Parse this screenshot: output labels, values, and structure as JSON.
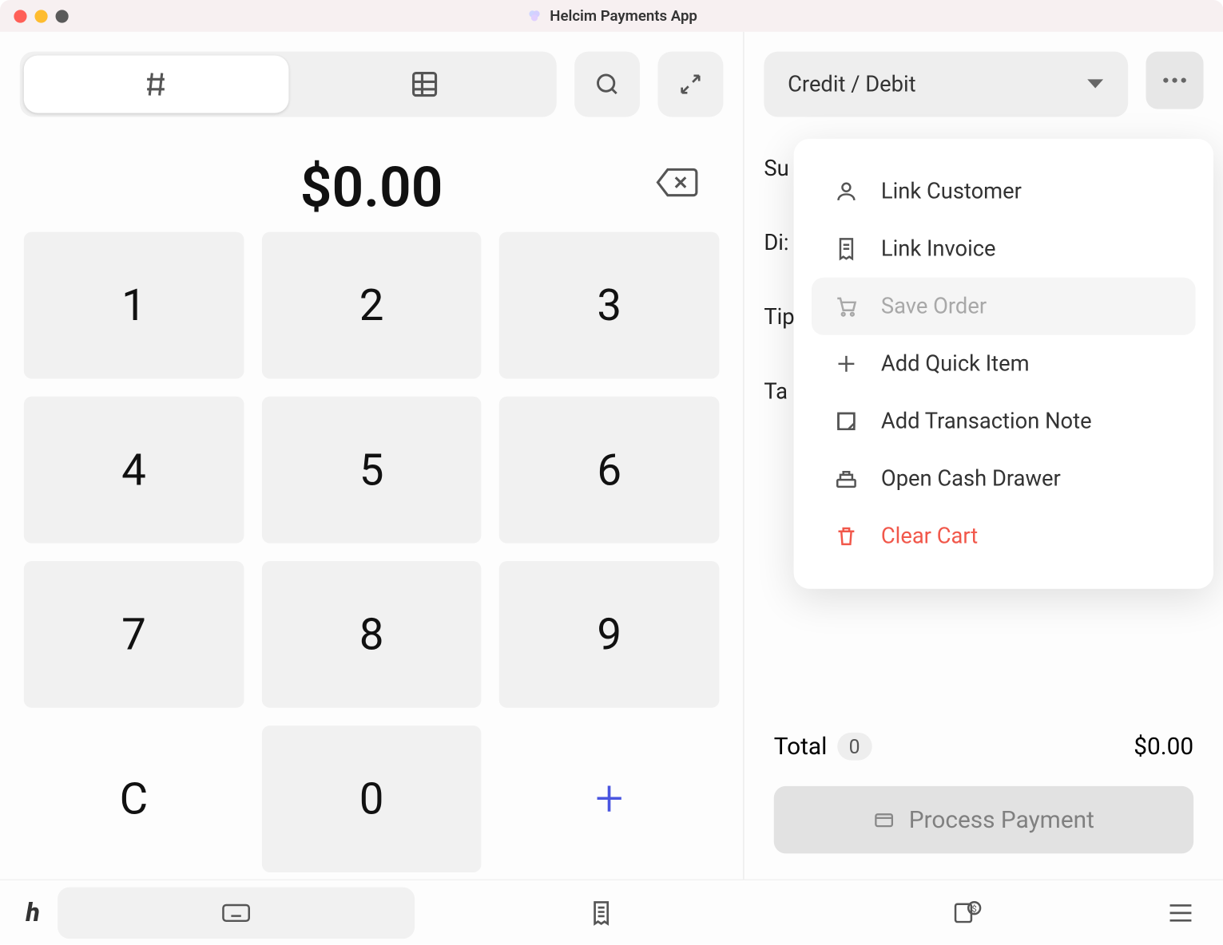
{
  "window": {
    "title": "Helcim Payments App"
  },
  "amount": {
    "display": "$0.00"
  },
  "keypad": {
    "keys": [
      "1",
      "2",
      "3",
      "4",
      "5",
      "6",
      "7",
      "8",
      "9",
      "C",
      "0",
      "+"
    ]
  },
  "payment": {
    "method": "Credit / Debit"
  },
  "summary": {
    "rows": [
      "Su",
      "Di:",
      "Tip",
      "Ta"
    ]
  },
  "menu": {
    "link_customer": "Link Customer",
    "link_invoice": "Link Invoice",
    "save_order": "Save Order",
    "add_quick_item": "Add Quick Item",
    "add_transaction_note": "Add Transaction Note",
    "open_cash_drawer": "Open Cash Drawer",
    "clear_cart": "Clear Cart"
  },
  "total": {
    "label": "Total",
    "count": "0",
    "amount": "$0.00"
  },
  "process": {
    "label": "Process Payment"
  }
}
